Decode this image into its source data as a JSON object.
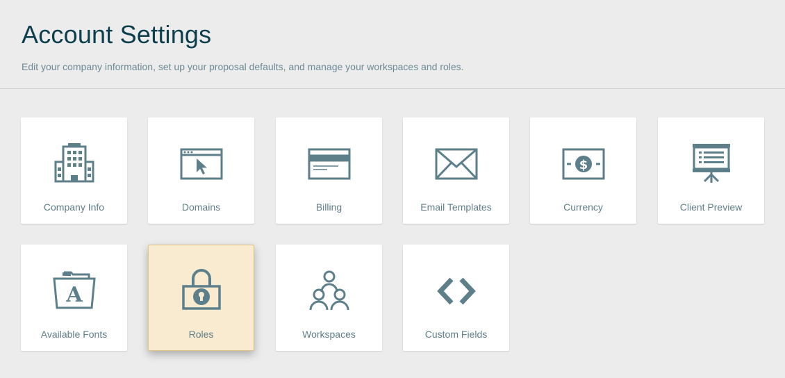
{
  "header": {
    "title": "Account Settings",
    "subtitle": "Edit your company information, set up your proposal defaults, and manage your workspaces and roles."
  },
  "tiles": [
    {
      "label": "Company Info",
      "icon": "building-icon"
    },
    {
      "label": "Domains",
      "icon": "browser-cursor-icon"
    },
    {
      "label": "Billing",
      "icon": "credit-card-icon"
    },
    {
      "label": "Email Templates",
      "icon": "envelope-icon"
    },
    {
      "label": "Currency",
      "icon": "dollar-bill-icon"
    },
    {
      "label": "Client Preview",
      "icon": "presentation-board-icon"
    },
    {
      "label": "Available Fonts",
      "icon": "font-folder-icon"
    },
    {
      "label": "Roles",
      "icon": "padlock-icon",
      "active": true
    },
    {
      "label": "Workspaces",
      "icon": "people-group-icon"
    },
    {
      "label": "Custom Fields",
      "icon": "code-brackets-icon"
    }
  ],
  "colors": {
    "background": "#ececec",
    "title": "#0d3e4c",
    "subtitle": "#6d8a95",
    "icon": "#5d7f8a",
    "label": "#5f7e89",
    "active_tile": "#f8ebcf"
  }
}
